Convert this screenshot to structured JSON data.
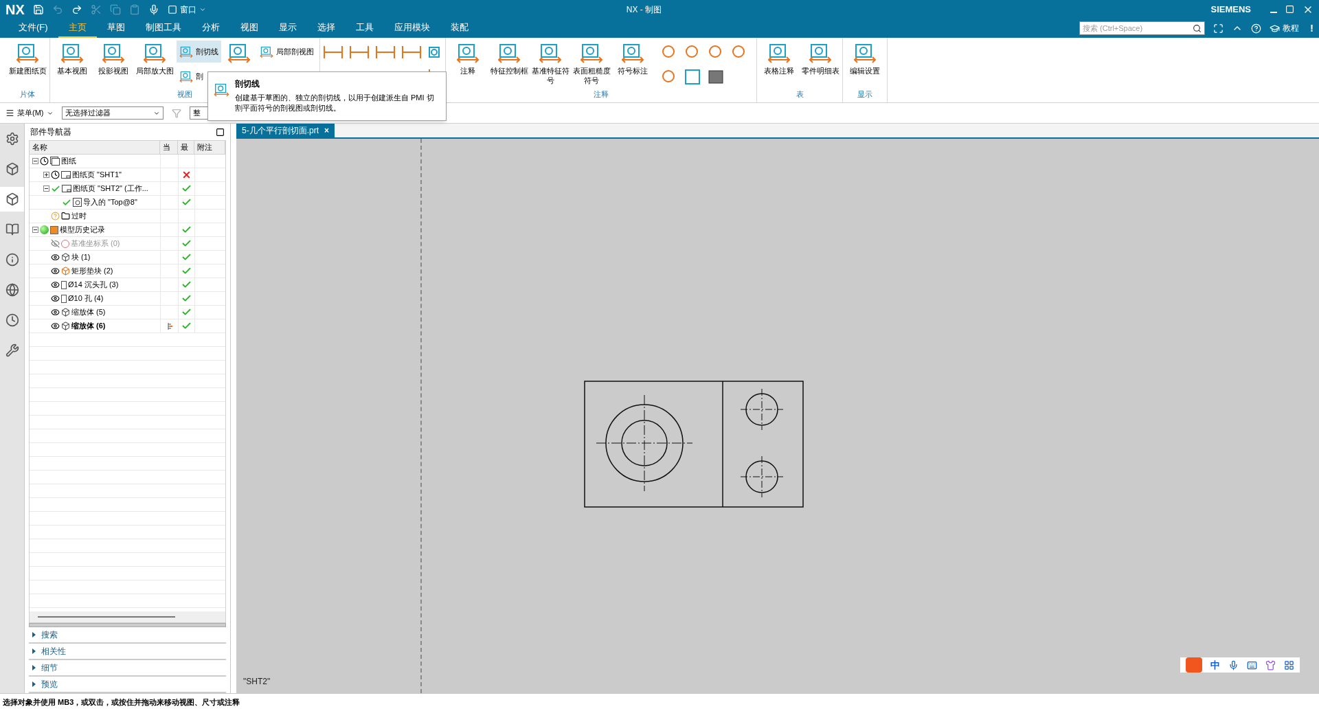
{
  "title_bar": {
    "logo": "NX",
    "window_menu": "窗口",
    "title": "NX - 制图",
    "brand": "SIEMENS"
  },
  "menu_tabs": [
    {
      "label": "文件(F)",
      "selected": false
    },
    {
      "label": "主页",
      "selected": true
    },
    {
      "label": "草图",
      "selected": false
    },
    {
      "label": "制图工具",
      "selected": false
    },
    {
      "label": "分析",
      "selected": false
    },
    {
      "label": "视图",
      "selected": false
    },
    {
      "label": "显示",
      "selected": false
    },
    {
      "label": "选择",
      "selected": false
    },
    {
      "label": "工具",
      "selected": false
    },
    {
      "label": "应用模块",
      "selected": false
    },
    {
      "label": "装配",
      "selected": false
    }
  ],
  "command_search": {
    "placeholder": "搜索 (Ctrl+Space)"
  },
  "help": {
    "tutorial": "教程",
    "alert": "!"
  },
  "ribbon": [
    {
      "caption": "片体",
      "buttons": [
        {
          "kind": "large",
          "label": "新建图纸页",
          "hovered": false
        }
      ]
    },
    {
      "caption": "视图",
      "buttons": [
        {
          "kind": "large",
          "label": "基本视图",
          "hovered": false
        },
        {
          "kind": "large",
          "label": "投影视图",
          "hovered": false
        },
        {
          "kind": "large",
          "label": "局部放大图",
          "hovered": false
        },
        {
          "kind": "small",
          "label": "剖切线",
          "hovered": true
        },
        {
          "kind": "small",
          "label": "剖",
          "hovered": false
        },
        {
          "kind": "icon",
          "hovered": false
        },
        {
          "kind": "small",
          "label": "局部剖视图",
          "hovered": false
        }
      ]
    },
    {
      "caption": "注释",
      "buttons": [
        {
          "kind": "large",
          "label": "注释",
          "hovered": false
        },
        {
          "kind": "large",
          "label": "特征控制框",
          "hovered": false
        },
        {
          "kind": "large",
          "label": "基准特征符号",
          "hovered": false
        },
        {
          "kind": "large",
          "label": "表面粗糙度符号",
          "hovered": false
        },
        {
          "kind": "large",
          "label": "符号标注",
          "hovered": false
        }
      ]
    },
    {
      "caption": "表",
      "buttons": [
        {
          "kind": "large",
          "label": "表格注释",
          "hovered": false
        },
        {
          "kind": "large",
          "label": "零件明细表",
          "hovered": false
        }
      ]
    },
    {
      "caption": "显示",
      "buttons": [
        {
          "kind": "large",
          "label": "编辑设置",
          "hovered": false
        }
      ]
    }
  ],
  "tooltip": {
    "title": "剖切线",
    "text": "创建基于草图的、独立的剖切线，以用于创建派生自 PMI 切割平面符号的剖视图或剖切线。"
  },
  "toolbar": {
    "menu": "菜单(M)",
    "filter": "无选择过滤器",
    "scope": "整"
  },
  "navigator": {
    "title": "部件导航器",
    "columns": [
      "名称",
      "当",
      "最",
      "附注"
    ],
    "tree": [
      {
        "label": "图纸",
        "kind": "drawing",
        "up_to_date": false,
        "expanded": true,
        "children": [
          {
            "label": "图纸页 \"SHT1\"",
            "kind": "sheet",
            "up_to_date": false,
            "expanded": false,
            "latest_ok": false
          },
          {
            "label": "图纸页 \"SHT2\" (工作...",
            "kind": "sheet",
            "up_to_date": true,
            "expanded": true,
            "latest_ok": true,
            "children": [
              {
                "label": "导入的 \"Top@8\"",
                "kind": "view",
                "up_to_date": true,
                "latest_ok": true
              }
            ]
          },
          {
            "label": "过时",
            "kind": "folder"
          }
        ]
      },
      {
        "label": "模型历史记录",
        "kind": "history",
        "expanded": true,
        "latest_ok": true,
        "children": [
          {
            "label": "基准坐标系 (0)",
            "kind": "csys",
            "visible": false,
            "current": false,
            "latest_ok": true
          },
          {
            "label": "块 (1)",
            "kind": "block",
            "visible": true,
            "current": false,
            "latest_ok": true
          },
          {
            "label": "矩形垫块 (2)",
            "kind": "pad",
            "visible": true,
            "current": false,
            "latest_ok": true
          },
          {
            "label": "Ø14 沉头孔 (3)",
            "kind": "counterbore",
            "visible": true,
            "current": false,
            "latest_ok": true
          },
          {
            "label": "Ø10 孔 (4)",
            "kind": "hole",
            "visible": true,
            "current": false,
            "latest_ok": true
          },
          {
            "label": "缩放体 (5)",
            "kind": "scale",
            "visible": true,
            "current": false,
            "latest_ok": true
          },
          {
            "label": "缩放体 (6)",
            "kind": "scale",
            "visible": true,
            "current": true,
            "latest_ok": true
          }
        ]
      }
    ],
    "sections": [
      {
        "label": "搜索",
        "expanded": false
      },
      {
        "label": "相关性",
        "expanded": false
      },
      {
        "label": "细节",
        "expanded": false
      },
      {
        "label": "预览",
        "expanded": false
      }
    ]
  },
  "document_tab": {
    "label": "5-几个平行剖切面.prt",
    "close": "×"
  },
  "sheet_label": "\"SHT2\"",
  "ime_bar": {
    "mode": "中"
  },
  "status_bar": "选择对象并使用 MB3，或双击，或按住并拖动来移动视图、尺寸或注释"
}
